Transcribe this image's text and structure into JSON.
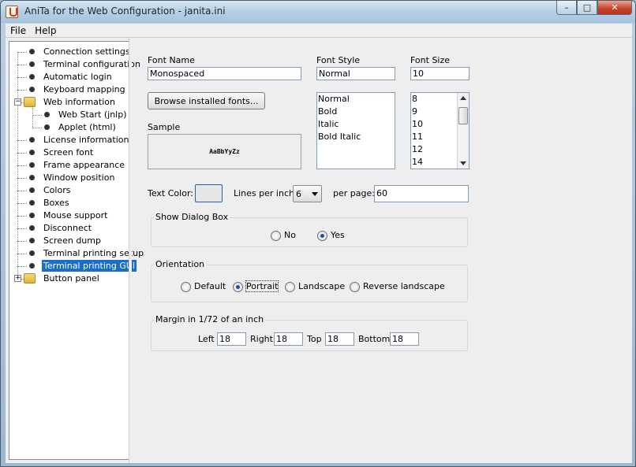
{
  "window": {
    "title": "AniTa for the Web Configuration - janita.ini"
  },
  "menu": [
    {
      "label": "File"
    },
    {
      "label": "Help"
    }
  ],
  "tree": [
    {
      "label": "Connection settings",
      "level": 0,
      "type": "leaf"
    },
    {
      "label": "Terminal configuration",
      "level": 0,
      "type": "leaf"
    },
    {
      "label": "Automatic login",
      "level": 0,
      "type": "leaf"
    },
    {
      "label": "Keyboard mapping",
      "level": 0,
      "type": "leaf"
    },
    {
      "label": "Web information",
      "level": 0,
      "type": "folder",
      "expanded": true
    },
    {
      "label": "Web Start (jnlp)",
      "level": 1,
      "type": "leaf"
    },
    {
      "label": "Applet (html)",
      "level": 1,
      "type": "leaf"
    },
    {
      "label": "License information",
      "level": 0,
      "type": "leaf"
    },
    {
      "label": "Screen font",
      "level": 0,
      "type": "leaf"
    },
    {
      "label": "Frame appearance",
      "level": 0,
      "type": "leaf"
    },
    {
      "label": "Window position",
      "level": 0,
      "type": "leaf"
    },
    {
      "label": "Colors",
      "level": 0,
      "type": "leaf"
    },
    {
      "label": "Boxes",
      "level": 0,
      "type": "leaf"
    },
    {
      "label": "Mouse support",
      "level": 0,
      "type": "leaf"
    },
    {
      "label": "Disconnect",
      "level": 0,
      "type": "leaf"
    },
    {
      "label": "Screen dump",
      "level": 0,
      "type": "leaf"
    },
    {
      "label": "Terminal printing setup",
      "level": 0,
      "type": "leaf"
    },
    {
      "label": "Terminal printing GUI",
      "level": 0,
      "type": "leaf",
      "selected": true
    },
    {
      "label": "Button panel",
      "level": 0,
      "type": "folder",
      "expanded": false
    }
  ],
  "font": {
    "name_label": "Font Name",
    "name_value": "Monospaced",
    "style_label": "Font Style",
    "style_value": "Normal",
    "size_label": "Font Size",
    "size_value": "10",
    "browse_button": "Browse installed fonts...",
    "style_options": [
      "Normal",
      "Bold",
      "Italic",
      "Bold Italic"
    ],
    "size_options": [
      "8",
      "9",
      "10",
      "11",
      "12",
      "14"
    ],
    "sample_label": "Sample",
    "sample_text": "AaBbYyZz"
  },
  "text_color": {
    "label": "Text Color:",
    "color": "#e6e6e6"
  },
  "lines": {
    "per_inch_label": "Lines per inch:",
    "per_inch_value": "6",
    "per_page_label": "per page:",
    "per_page_value": "60"
  },
  "dialog_box": {
    "title": "Show Dialog Box",
    "options": [
      {
        "label": "No",
        "checked": false
      },
      {
        "label": "Yes",
        "checked": true
      }
    ]
  },
  "orientation": {
    "title": "Orientation",
    "options": [
      {
        "label": "Default",
        "checked": false
      },
      {
        "label": "Portrait",
        "checked": true
      },
      {
        "label": "Landscape",
        "checked": false
      },
      {
        "label": "Reverse landscape",
        "checked": false
      }
    ]
  },
  "margin": {
    "title": "Margin in 1/72 of an inch",
    "left_label": "Left",
    "left_value": "18",
    "right_label": "Right",
    "right_value": "18",
    "top_label": "Top",
    "top_value": "18",
    "bottom_label": "Bottom",
    "bottom_value": "18"
  },
  "colors": {
    "selection": "#1a6dc9",
    "close_button": "#c64128"
  }
}
